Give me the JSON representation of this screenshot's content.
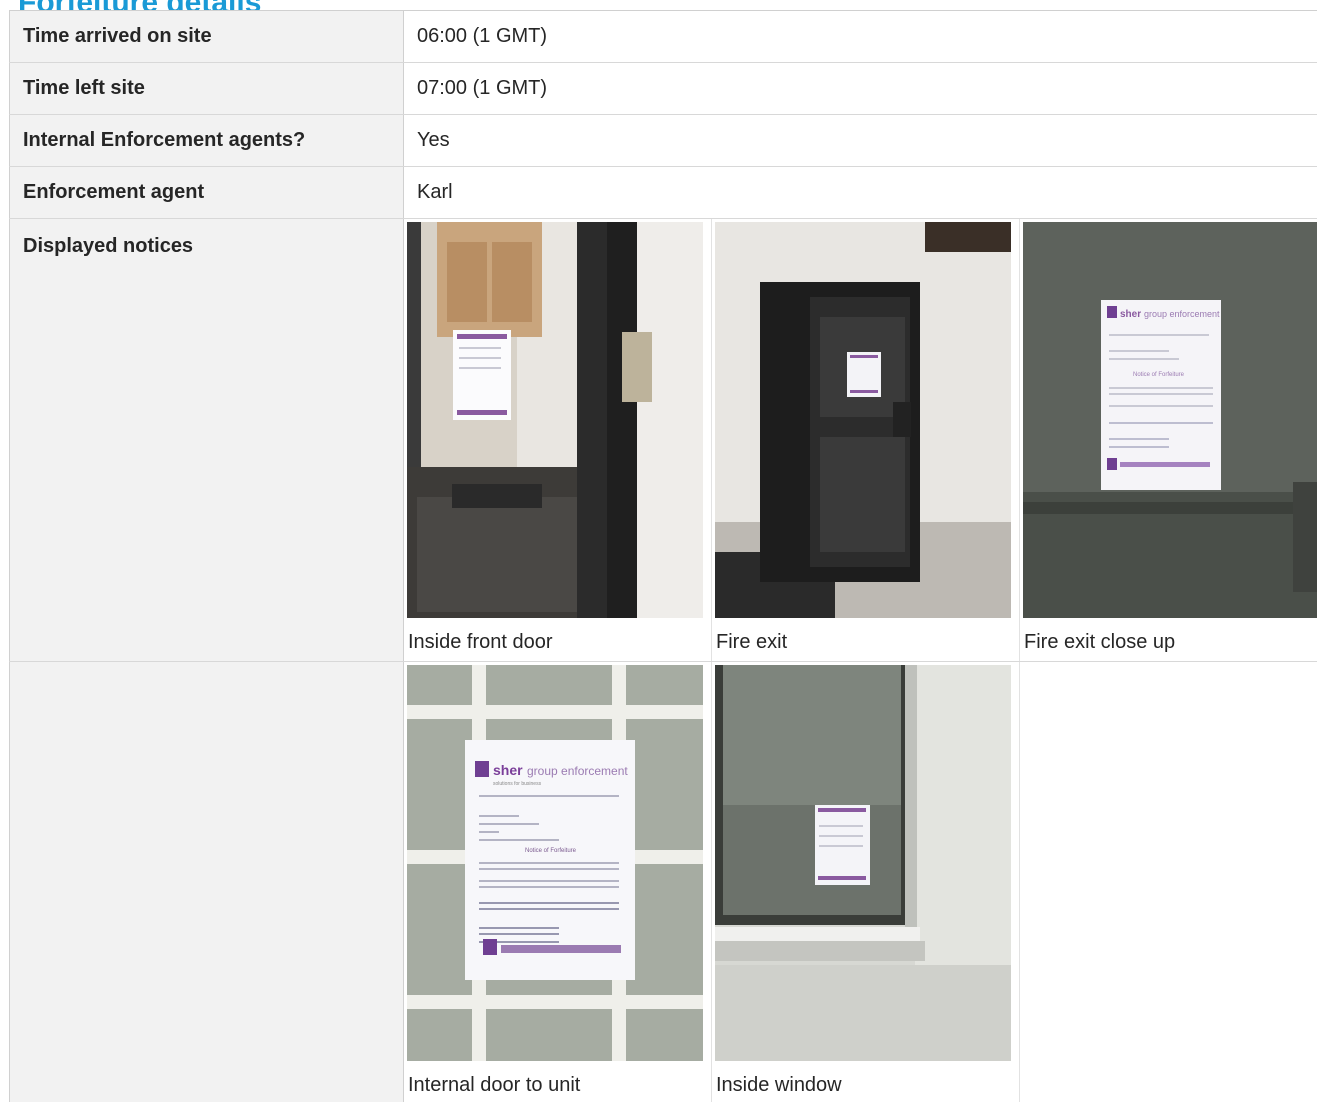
{
  "page": {
    "title": "Forfeiture details"
  },
  "rows": [
    {
      "label": "Time arrived on site",
      "value": "06:00 (1 GMT)"
    },
    {
      "label": "Time left site",
      "value": "07:00 (1 GMT)"
    },
    {
      "label": "Internal Enforcement agents?",
      "value": "Yes"
    },
    {
      "label": "Enforcement agent",
      "value": "Karl"
    }
  ],
  "notices": {
    "label": "Displayed notices",
    "photos": [
      {
        "caption": "Inside front door",
        "icon": "door-photo"
      },
      {
        "caption": "Fire exit",
        "icon": "door-photo"
      },
      {
        "caption": "Fire exit close up",
        "icon": "notice-photo"
      },
      {
        "caption": "Internal door to unit",
        "icon": "notice-photo"
      },
      {
        "caption": "Inside window",
        "icon": "window-photo"
      }
    ]
  },
  "notice_text": {
    "brand_strong": "sher",
    "brand_rest": "group enforcement",
    "tagline": "solutions for business",
    "heading": "Notice of Forfeiture"
  }
}
